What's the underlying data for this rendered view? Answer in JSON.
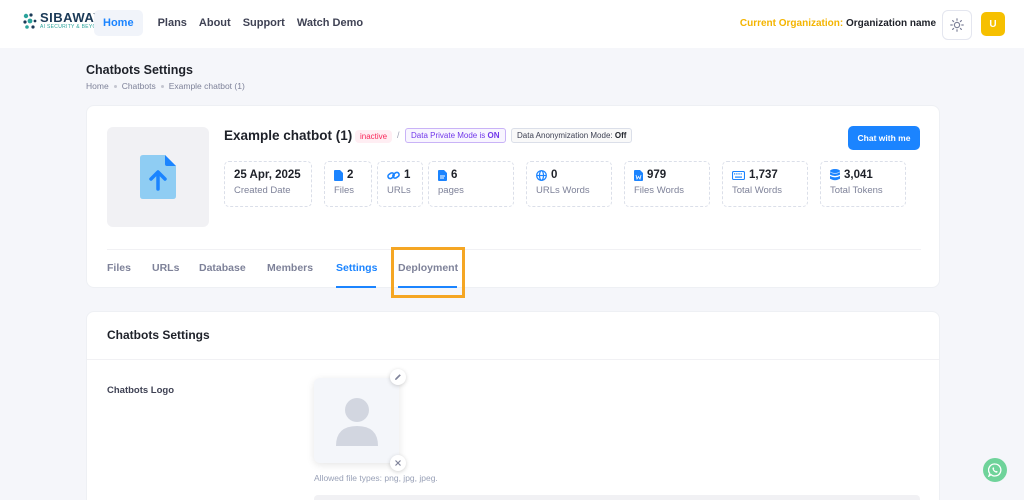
{
  "brand": {
    "name": "SIBAWAY",
    "tagline": "AI SECURITY & BEYOND",
    "colors": {
      "primary": "#1b84ff",
      "accent": "#f6c000",
      "highlight": "#f5a623"
    }
  },
  "nav": {
    "items": [
      {
        "label": "Home",
        "active": true
      },
      {
        "label": "Plans"
      },
      {
        "label": "About"
      },
      {
        "label": "Support"
      },
      {
        "label": "Watch Demo"
      }
    ]
  },
  "org": {
    "label": "Current Organization:",
    "value": "Organization name"
  },
  "user": {
    "initial": "U"
  },
  "page": {
    "title": "Chatbots Settings",
    "breadcrumb": [
      "Home",
      "Chatbots",
      "Example chatbot (1)"
    ]
  },
  "chatbot": {
    "name": "Example chatbot (1)",
    "status": "inactive",
    "separator": "/",
    "private_mode": {
      "text": "Data Private Mode is",
      "value": "ON"
    },
    "anonymization": {
      "text": "Data Anonymization Mode:",
      "value": "Off"
    },
    "chat_button": "Chat with me",
    "thumbnail_icon": "upload-file-icon"
  },
  "stats": [
    {
      "value": "25 Apr, 2025",
      "label": "Created Date",
      "icon": null
    },
    {
      "value": "2",
      "label": "Files",
      "icon": "file-icon"
    },
    {
      "value": "1",
      "label": "URLs",
      "icon": "link-icon"
    },
    {
      "value": "6",
      "label": "pages",
      "icon": "document-icon"
    },
    {
      "value": "0",
      "label": "URLs Words",
      "icon": "globe-icon"
    },
    {
      "value": "979",
      "label": "Files Words",
      "icon": "word-file-icon"
    },
    {
      "value": "1,737",
      "label": "Total Words",
      "icon": "keyboard-icon"
    },
    {
      "value": "3,041",
      "label": "Total Tokens",
      "icon": "database-icon"
    }
  ],
  "tabs": [
    {
      "label": "Files"
    },
    {
      "label": "URLs"
    },
    {
      "label": "Database"
    },
    {
      "label": "Members"
    },
    {
      "label": "Settings",
      "active": true
    },
    {
      "label": "Deployment",
      "highlighted": true
    }
  ],
  "settings": {
    "title": "Chatbots Settings",
    "logo_label": "Chatbots Logo",
    "allowed_types": "Allowed file types: png, jpg, jpeg."
  }
}
